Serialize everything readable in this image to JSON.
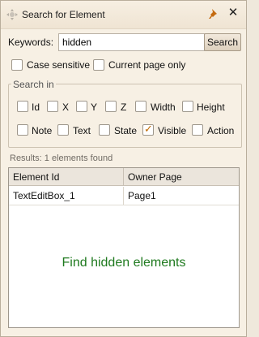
{
  "window": {
    "title": "Search for Element"
  },
  "search": {
    "label": "Keywords:",
    "value": "hidden",
    "button_label": "Search"
  },
  "options": [
    {
      "label": "Case sensitive",
      "checked": false
    },
    {
      "label": "Current page only",
      "checked": false
    }
  ],
  "search_in": {
    "legend": "Search in",
    "fields": [
      {
        "label": "Id",
        "checked": false
      },
      {
        "label": "X",
        "checked": false
      },
      {
        "label": "Y",
        "checked": false
      },
      {
        "label": "Z",
        "checked": false
      },
      {
        "label": "Width",
        "checked": false
      },
      {
        "label": "Height",
        "checked": false
      },
      {
        "label": "Note",
        "checked": false
      },
      {
        "label": "Text",
        "checked": false
      },
      {
        "label": "State",
        "checked": false
      },
      {
        "label": "Visible",
        "checked": true
      },
      {
        "label": "Action",
        "checked": false
      }
    ]
  },
  "results": {
    "summary": "Results: 1 elements found",
    "columns": [
      "Element Id",
      "Owner Page"
    ],
    "rows": [
      [
        "TextEditBox_1",
        "Page1"
      ]
    ],
    "message": "Find hidden elements"
  },
  "colors": {
    "accent_check": "#c06a00",
    "message": "#1f7a1f"
  }
}
